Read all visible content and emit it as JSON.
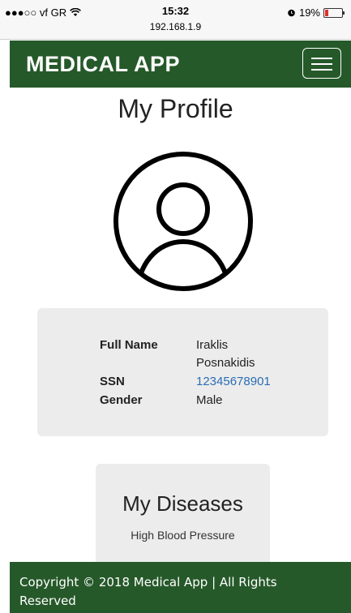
{
  "status_bar": {
    "carrier": "●●●○○ vf GR",
    "time": "15:32",
    "url": "192.168.1.9",
    "battery": "19%",
    "battery_level": 0.19
  },
  "navbar": {
    "brand": "MEDICAL APP",
    "menu_icon": "hamburger-icon"
  },
  "page": {
    "title": "My Profile",
    "avatar_icon": "user-avatar-icon"
  },
  "profile": {
    "full_name_label": "Full Name",
    "full_name_line1": "Iraklis",
    "full_name_line2": "Posnakidis",
    "ssn_label": "SSN",
    "ssn_value": "12345678901",
    "gender_label": "Gender",
    "gender_value": "Male"
  },
  "diseases": {
    "title": "My Diseases",
    "items": [
      "High Blood Pressure"
    ]
  },
  "footer": {
    "text": "Copyright © 2018 Medical App | All Rights Reserved"
  },
  "colors": {
    "brand_green": "#26592a",
    "link_blue": "#2a6db5",
    "card_gray": "#ececec"
  }
}
